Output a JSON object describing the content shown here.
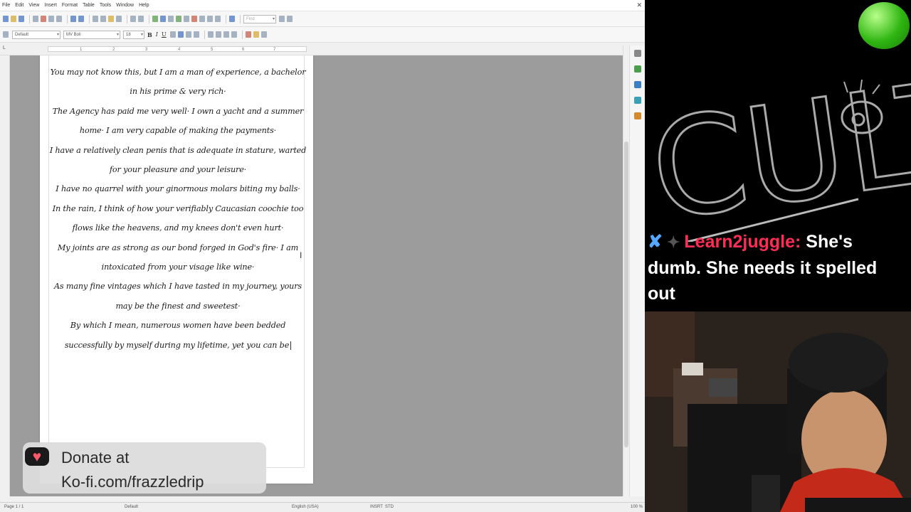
{
  "menubar": {
    "items": [
      "File",
      "Edit",
      "View",
      "Insert",
      "Format",
      "Table",
      "Tools",
      "Window",
      "Help"
    ]
  },
  "toolbar": {
    "find_placeholder": "Find",
    "style_value": "Default",
    "font_value": "MV Boli",
    "size_value": "18"
  },
  "ruler": {
    "numbers": [
      "1",
      "2",
      "3",
      "4",
      "5",
      "6",
      "7"
    ]
  },
  "document": {
    "paragraphs": [
      "You may not know this, but I am a man of experience, a bachelor in his prime & very rich·",
      "The Agency has paid me very well· I own a yacht and a summer home· I am very capable of making the payments·",
      "I have a relatively clean penis that is adequate in stature, warted for your pleasure and your leisure·",
      "I have no quarrel with your ginormous molars biting my balls·",
      "In the rain, I think of how your verifiably Caucasian coochie too flows like the heavens, and my knees don't even hurt·",
      "My joints are as strong as our bond forged in God's fire· I am intoxicated from your visage like wine·",
      "As many fine vintages which I have tasted in my journey, yours may be the finest and sweetest·",
      "By which I mean, numerous women have been bedded successfully by myself during my lifetime, yet you can be"
    ]
  },
  "statusbar": {
    "page": "Page 1 / 1",
    "style": "Default",
    "language": "English (USA)",
    "mode": "INSRT",
    "selection": "STD",
    "zoom": "100 %"
  },
  "donate": {
    "line1": "Donate at",
    "line2": "Ko-fi.com/frazzledrip"
  },
  "stream": {
    "logo_text": "CULT",
    "chat": {
      "username": "Learn2juggle:",
      "message": "She's dumb. She needs it spelled out"
    }
  },
  "colors": {
    "chat_user": "#ff2d55",
    "status_indicator": "#2fb512",
    "donate_heart": "#ff5a6b"
  },
  "icons": [
    "sword-badge-icon",
    "heart-icon",
    "text-cursor-icon",
    "close-icon"
  ]
}
